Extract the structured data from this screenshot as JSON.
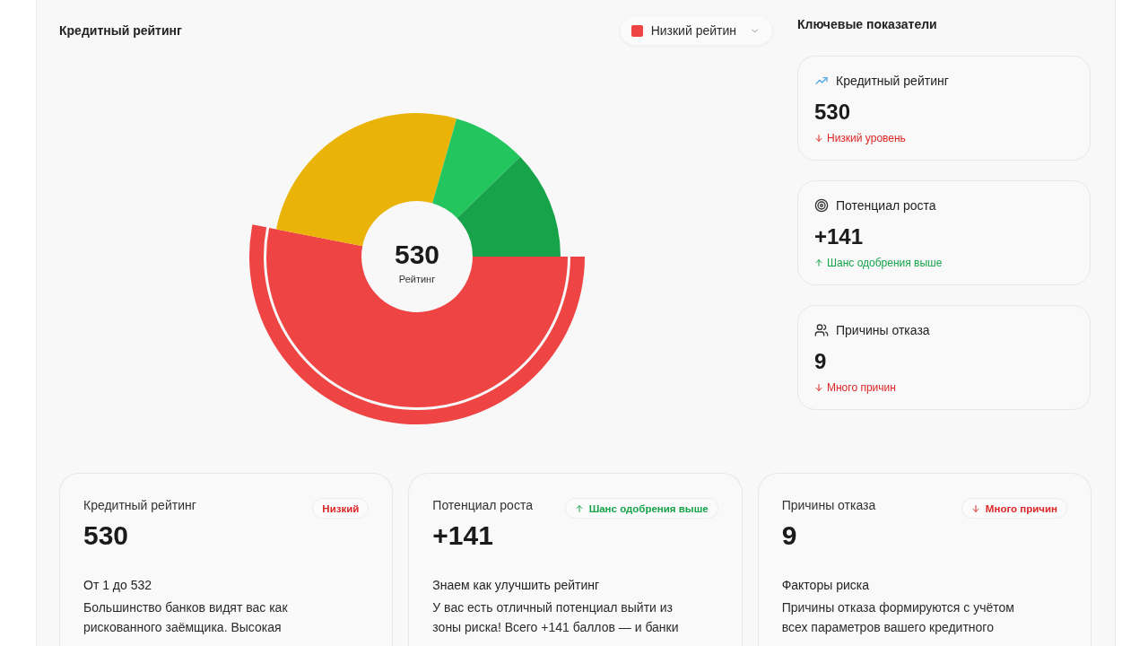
{
  "rating_panel": {
    "title": "Кредитный рейтинг",
    "filter": {
      "label": "Низкий рейтин"
    },
    "chart": {
      "value": "530",
      "label": "Рейтинг",
      "segments": [
        {
          "color": "#ef4444",
          "selected": true
        },
        {
          "color": "#eab308",
          "selected": false
        },
        {
          "color": "#22c55e",
          "selected": false
        },
        {
          "color": "#16a34a",
          "selected": false
        }
      ]
    }
  },
  "key_metrics": {
    "title": "Ключевые показатели",
    "cards": [
      {
        "title": "Кредитный рейтинг",
        "value": "530",
        "note": {
          "kind": "down",
          "label": "Низкий уровень"
        }
      },
      {
        "title": "Потенциал роста",
        "value": "+141",
        "note": {
          "kind": "up",
          "label": "Шанс одобрения выше"
        }
      },
      {
        "title": "Причины отказа",
        "value": "9",
        "note": {
          "kind": "down",
          "label": "Много причин"
        }
      }
    ]
  },
  "summary_cards": [
    {
      "title": "Кредитный рейтинг",
      "badge": {
        "kind": "low",
        "label": "Низкий"
      },
      "value": "530",
      "subtitle": "От 1 до 532",
      "text": "Большинство банков видят вас как рискованного заёмщика. Высокая"
    },
    {
      "title": "Потенциал роста",
      "badge": {
        "kind": "up",
        "label": "Шанс одобрения выше"
      },
      "value": "+141",
      "subtitle": "Знаем как улучшить рейтинг",
      "text": "У вас есть отличный потенциал выйти из зоны риска! Всего +141 баллов — и банки"
    },
    {
      "title": "Причины отказа",
      "badge": {
        "kind": "down",
        "label": "Много причин"
      },
      "value": "9",
      "subtitle": "Факторы риска",
      "text": "Причины отказа формируются с учётом всех параметров вашего кредитного"
    }
  ]
}
